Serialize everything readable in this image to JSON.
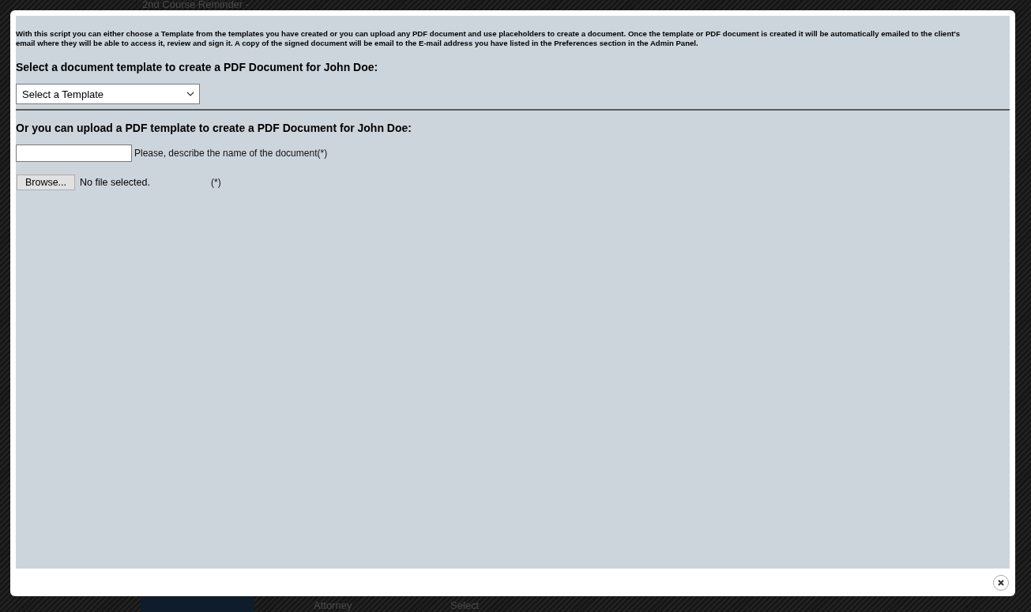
{
  "background": {
    "top_label": "2nd Course Reminder -",
    "bottom_labels": [
      "Attorney",
      "Select"
    ]
  },
  "dialog": {
    "intro": "With this script you can either choose a Template from the templates you have created or you can upload any PDF document and use placeholders to create a document. Once the template or PDF document is created it will be automatically emailed to the client's email where they will be able to access it, review and sign it. A copy of the signed document will be email to the E-mail address you have listed in the Preferences section in the Admin Panel.",
    "template_heading": "Select a document template to create a PDF Document for John Doe:",
    "template_select": {
      "value": "Select a Template"
    },
    "upload_heading": "Or you can upload a PDF template to create a PDF Document for John Doe:",
    "name_field": {
      "label": "Please, describe the name of the document(*)"
    },
    "file_input": {
      "button": "Browse...",
      "status": "No file selected.",
      "required_mark": "(*)"
    }
  }
}
